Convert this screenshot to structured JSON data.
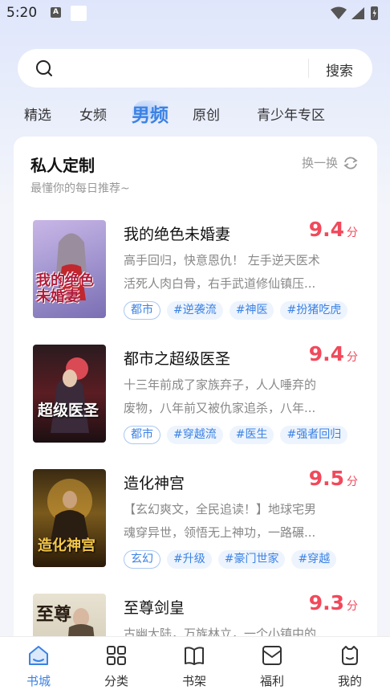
{
  "status_bar": {
    "time": "5:20",
    "notif_icon": "A"
  },
  "search": {
    "placeholder": "",
    "button_label": "搜索"
  },
  "tabs": [
    {
      "label": "精选",
      "active": false
    },
    {
      "label": "女频",
      "active": false
    },
    {
      "label": "男频",
      "active": true
    },
    {
      "label": "原创",
      "active": false
    },
    {
      "label": "青少年专区",
      "active": false
    }
  ],
  "section": {
    "title": "私人定制",
    "subtitle": "最懂你的每日推荐~",
    "refresh_label": "换一换"
  },
  "books": [
    {
      "title": "我的绝色未婚妻",
      "score": "9.4",
      "unit": "分",
      "desc_line1": "高手回归，快意恩仇！ 左手逆天医术",
      "desc_line2": "活死人肉白骨，右手武道修仙镇压...",
      "tags": [
        "都市",
        "#逆袭流",
        "#神医",
        "#扮猪吃虎"
      ],
      "cover_text": "我的绝色未婚妻"
    },
    {
      "title": "都市之超级医圣",
      "score": "9.4",
      "unit": "分",
      "desc_line1": "十三年前成了家族弃子，人人唾弃的",
      "desc_line2": "废物，八年前又被仇家追杀，八年...",
      "tags": [
        "都市",
        "#穿越流",
        "#医生",
        "#强者回归"
      ],
      "cover_text": "超级医圣"
    },
    {
      "title": "造化神宫",
      "score": "9.5",
      "unit": "分",
      "desc_line1": "【玄幻爽文，全民追读！】地球宅男",
      "desc_line2": "魂穿异世，领悟无上神功，一路碾...",
      "tags": [
        "玄幻",
        "#升级",
        "#豪门世家",
        "#穿越"
      ],
      "cover_text": "造化神宫"
    },
    {
      "title": "至尊剑皇",
      "score": "9.3",
      "unit": "分",
      "desc_line1": "古幽大陆，万族林立，一个小镇中的",
      "desc_line2": "",
      "tags": [],
      "cover_text": "至尊"
    }
  ],
  "bottom_nav": [
    {
      "label": "书城",
      "icon": "home-icon",
      "active": true
    },
    {
      "label": "分类",
      "icon": "category-icon",
      "active": false
    },
    {
      "label": "书架",
      "icon": "bookshelf-icon",
      "active": false
    },
    {
      "label": "福利",
      "icon": "welfare-icon",
      "active": false
    },
    {
      "label": "我的",
      "icon": "profile-icon",
      "active": false
    }
  ],
  "colors": {
    "accent": "#3b82e4",
    "score": "#f1495b"
  }
}
